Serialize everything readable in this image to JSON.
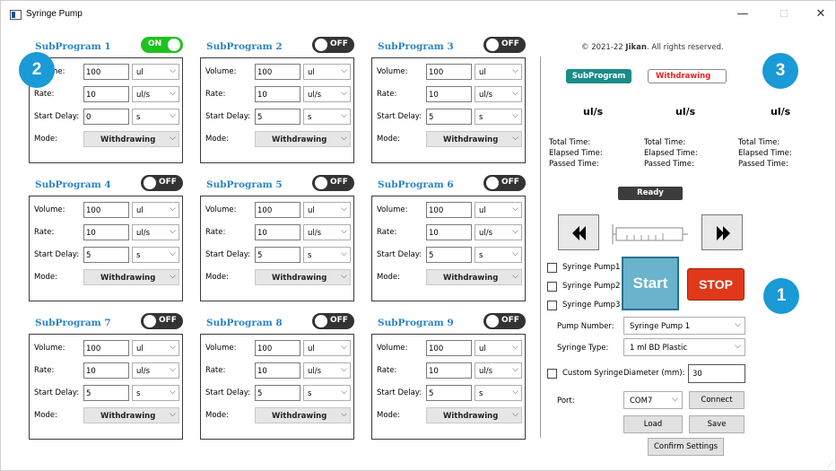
{
  "window": {
    "title": "Syringe Pump",
    "min_glyph": "—",
    "max_glyph": "☐",
    "close_glyph": "✕"
  },
  "subprograms": [
    {
      "title": "SubProgram 1",
      "state": "ON",
      "volume": "100",
      "volume_unit": "ul",
      "rate": "10",
      "rate_unit": "ul/s",
      "delay": "0",
      "delay_unit": "s",
      "mode": "Withdrawing"
    },
    {
      "title": "SubProgram 2",
      "state": "OFF",
      "volume": "100",
      "volume_unit": "ul",
      "rate": "10",
      "rate_unit": "ul/s",
      "delay": "5",
      "delay_unit": "s",
      "mode": "Withdrawing"
    },
    {
      "title": "SubProgram 3",
      "state": "OFF",
      "volume": "100",
      "volume_unit": "ul",
      "rate": "10",
      "rate_unit": "ul/s",
      "delay": "5",
      "delay_unit": "s",
      "mode": "Withdrawing"
    },
    {
      "title": "SubProgram 4",
      "state": "OFF",
      "volume": "100",
      "volume_unit": "ul",
      "rate": "10",
      "rate_unit": "ul/s",
      "delay": "5",
      "delay_unit": "s",
      "mode": "Withdrawing"
    },
    {
      "title": "SubProgram 5",
      "state": "OFF",
      "volume": "100",
      "volume_unit": "ul",
      "rate": "10",
      "rate_unit": "ul/s",
      "delay": "5",
      "delay_unit": "s",
      "mode": "Withdrawing"
    },
    {
      "title": "SubProgram 6",
      "state": "OFF",
      "volume": "100",
      "volume_unit": "ul",
      "rate": "10",
      "rate_unit": "ul/s",
      "delay": "5",
      "delay_unit": "s",
      "mode": "Withdrawing"
    },
    {
      "title": "SubProgram 7",
      "state": "OFF",
      "volume": "100",
      "volume_unit": "ul",
      "rate": "10",
      "rate_unit": "ul/s",
      "delay": "5",
      "delay_unit": "s",
      "mode": "Withdrawing"
    },
    {
      "title": "SubProgram 8",
      "state": "OFF",
      "volume": "100",
      "volume_unit": "ul",
      "rate": "10",
      "rate_unit": "ul/s",
      "delay": "5",
      "delay_unit": "s",
      "mode": "Withdrawing"
    },
    {
      "title": "SubProgram 9",
      "state": "OFF",
      "volume": "100",
      "volume_unit": "ul",
      "rate": "10",
      "rate_unit": "ul/s",
      "delay": "5",
      "delay_unit": "s",
      "mode": "Withdrawing"
    }
  ],
  "labels": {
    "volume": "Volume:",
    "rate": "Rate:",
    "start_delay": "Start Delay:",
    "mode": "Mode:"
  },
  "badges": {
    "b1": "1",
    "b2": "2",
    "b3": "3"
  },
  "panel": {
    "copyright_prefix": "© 2021-22 ",
    "copyright_brand": "Jikan",
    "copyright_suffix": ". All rights reserved.",
    "subprogram_tag": "SubProgram",
    "withdrawing_tag": "Withdrawing",
    "rate_units": [
      "ul/s",
      "ul/s",
      "ul/s"
    ],
    "total_time": "Total Time:",
    "elapsed_time": "Elapsed Time:",
    "passed_time": "Passed Time:",
    "status": "Ready",
    "pumps": [
      "Syringe Pump1",
      "Syringe Pump2",
      "Syringe Pump3"
    ],
    "start": "Start",
    "stop": "STOP",
    "pump_number_label": "Pump Number:",
    "pump_number_value": "Syringe Pump 1",
    "syringe_type_label": "Syringe Type:",
    "syringe_type_value": "1 ml BD Plastic",
    "custom_syringe": "Custom Syringe",
    "diameter_label": "Diameter (mm):",
    "diameter_value": "30",
    "port_label": "Port:",
    "port_value": "COM7",
    "connect": "Connect",
    "load": "Load",
    "save": "Save",
    "confirm": "Confirm Settings"
  },
  "colors": {
    "accent": "#2a84c2",
    "toggle_on": "#1ec21e",
    "toggle_off": "#333333",
    "start": "#69b3cc",
    "stop": "#e0391a",
    "badge": "#1a9ad6",
    "subprogram_tag": "#1a8c8a"
  }
}
